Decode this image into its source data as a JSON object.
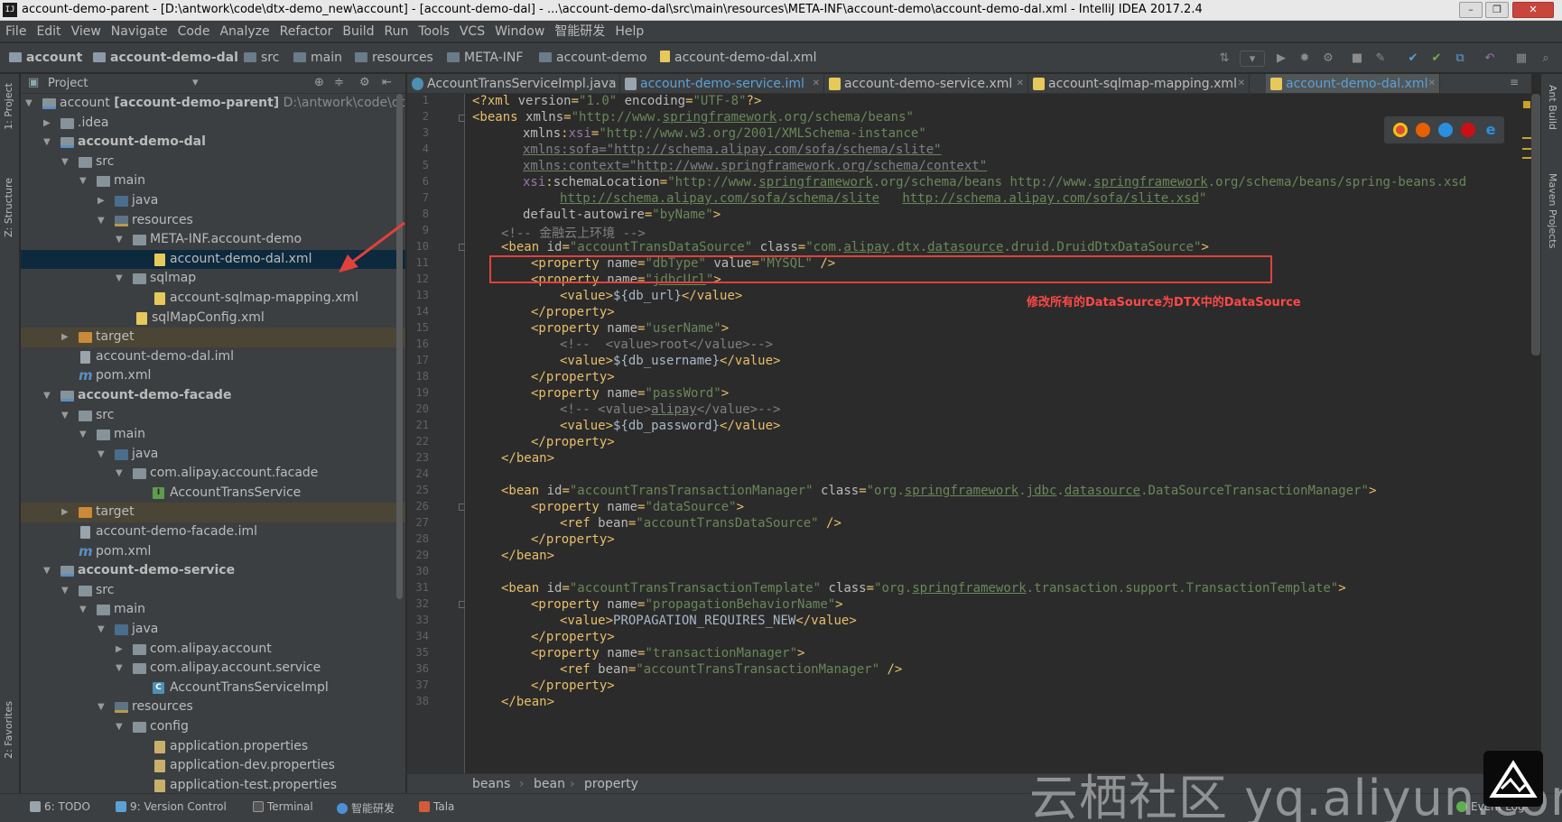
{
  "window": {
    "title": "account-demo-parent - [D:\\antwork\\code\\dtx-demo_new\\account] - [account-demo-dal] - ...\\account-demo-dal\\src\\main\\resources\\META-INF\\account-demo\\account-demo-dal.xml - IntelliJ IDEA 2017.2.4",
    "app_icon": "IJ"
  },
  "menu": [
    "File",
    "Edit",
    "View",
    "Navigate",
    "Code",
    "Analyze",
    "Refactor",
    "Build",
    "Run",
    "Tools",
    "VCS",
    "Window",
    "智能研发",
    "Help"
  ],
  "nav_crumbs": [
    "account",
    "account-demo-dal",
    "src",
    "main",
    "resources",
    "META-INF",
    "account-demo",
    "account-demo-dal.xml"
  ],
  "project_panel": {
    "title": "Project",
    "rows": [
      {
        "label": "account [account-demo-parent]",
        "path": "D:\\antwork\\code\\dtx-d"
      },
      {
        "label": ".idea"
      },
      {
        "label": "account-demo-dal"
      },
      {
        "label": "src"
      },
      {
        "label": "main"
      },
      {
        "label": "java"
      },
      {
        "label": "resources"
      },
      {
        "label": "META-INF.account-demo"
      },
      {
        "label": "account-demo-dal.xml"
      },
      {
        "label": "sqlmap"
      },
      {
        "label": "account-sqlmap-mapping.xml"
      },
      {
        "label": "sqlMapConfig.xml"
      },
      {
        "label": "target"
      },
      {
        "label": "account-demo-dal.iml"
      },
      {
        "label": "pom.xml"
      },
      {
        "label": "account-demo-facade"
      },
      {
        "label": "src"
      },
      {
        "label": "main"
      },
      {
        "label": "java"
      },
      {
        "label": "com.alipay.account.facade"
      },
      {
        "label": "AccountTransService"
      },
      {
        "label": "target"
      },
      {
        "label": "account-demo-facade.iml"
      },
      {
        "label": "pom.xml"
      },
      {
        "label": "account-demo-service"
      },
      {
        "label": "src"
      },
      {
        "label": "main"
      },
      {
        "label": "java"
      },
      {
        "label": "com.alipay.account"
      },
      {
        "label": "com.alipay.account.service"
      },
      {
        "label": "AccountTransServiceImpl"
      },
      {
        "label": "resources"
      },
      {
        "label": "config"
      },
      {
        "label": "application.properties"
      },
      {
        "label": "application-dev.properties"
      },
      {
        "label": "application-test.properties"
      }
    ]
  },
  "tabs": [
    {
      "label": "AccountTransServiceImpl.java"
    },
    {
      "label": "account-demo-service.iml"
    },
    {
      "label": "account-demo-service.xml"
    },
    {
      "label": "account-sqlmap-mapping.xml"
    },
    {
      "label": "account-demo-dal.xml"
    }
  ],
  "line_numbers": [
    "1",
    "2",
    "3",
    "4",
    "5",
    "6",
    "7",
    "8",
    "9",
    "10",
    "11",
    "12",
    "13",
    "14",
    "15",
    "16",
    "17",
    "18",
    "19",
    "20",
    "21",
    "22",
    "23",
    "24",
    "25",
    "26",
    "27",
    "28",
    "29",
    "30",
    "31",
    "32",
    "33",
    "34",
    "35",
    "36",
    "37",
    "38"
  ],
  "annotation": "修改所有的DataSource为DTX中的DataSource",
  "breadcrumb": [
    "beans",
    "bean",
    "property"
  ],
  "left_strip": {
    "project": "1: Project",
    "structure": "Z: Structure",
    "favorites": "2: Favorites"
  },
  "right_strip": {
    "ant": "Ant Build",
    "maven": "Maven Projects"
  },
  "status_items": [
    "6: TODO",
    "9: Version Control",
    "Terminal",
    "智能研发",
    "Tala",
    "Event Log"
  ],
  "watermark": "云栖社区 yq.aliyun.com",
  "colors": {
    "annotation_red": "#ff4848",
    "box_red": "#e0413b",
    "active_tab_text": "#5aa1d6",
    "selected_row": "#0d293e"
  }
}
